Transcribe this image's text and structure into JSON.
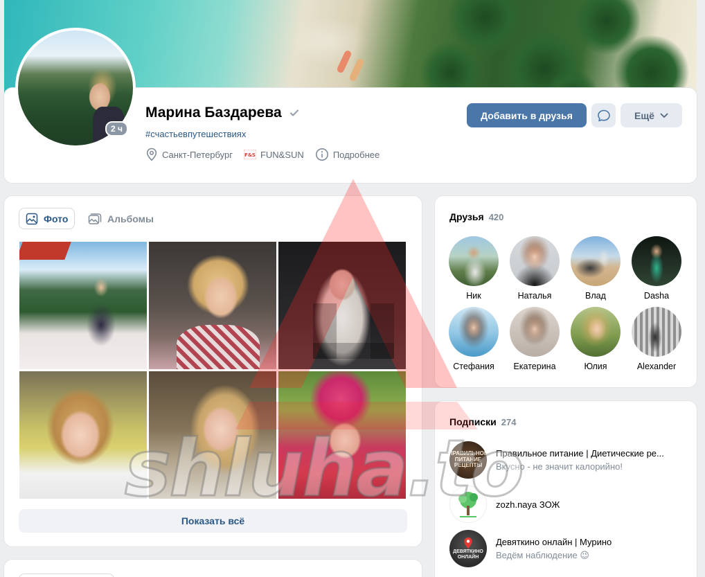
{
  "profile": {
    "name": "Марина Баздарева",
    "status": "#счастьевпутешествиях",
    "online_badge": "2 ч",
    "city": "Санкт-Петербург",
    "workplace": "FUN&SUN",
    "more_info": "Подробнее",
    "add_friend": "Добавить в друзья",
    "more": "Ещё"
  },
  "photos": {
    "tabs": [
      {
        "label": "Фото",
        "active": true
      },
      {
        "label": "Альбомы",
        "active": false
      }
    ],
    "show_all": "Показать всё"
  },
  "friends": {
    "title": "Друзья",
    "count": "420",
    "items": [
      {
        "name": "Ник"
      },
      {
        "name": "Наталья"
      },
      {
        "name": "Влад"
      },
      {
        "name": "Dasha"
      },
      {
        "name": "Стефания"
      },
      {
        "name": "Екатерина"
      },
      {
        "name": "Юлия"
      },
      {
        "name": "Alexander"
      }
    ]
  },
  "subscriptions": {
    "title": "Подписки",
    "count": "274",
    "items": [
      {
        "name": "Правильное питание | Диетические ре...",
        "desc": "Вкусно - не значит калорийно!",
        "avatar_text": "ПРАВИЛЬНОЕ ПИТАНИЕ РЕЦЕПТЫ"
      },
      {
        "name": "zozh.naya ЗОЖ",
        "desc": ""
      },
      {
        "name": "Девяткино онлайн | Мурино",
        "desc": "Ведём наблюдение 😉",
        "avatar_text": "ДЕВЯТКИНО ОНЛАЙН"
      }
    ]
  },
  "watermark": "shluha.to",
  "colors": {
    "accent": "#4a76a8",
    "link": "#2a5885",
    "muted": "#818c99",
    "background": "#edeef0"
  }
}
